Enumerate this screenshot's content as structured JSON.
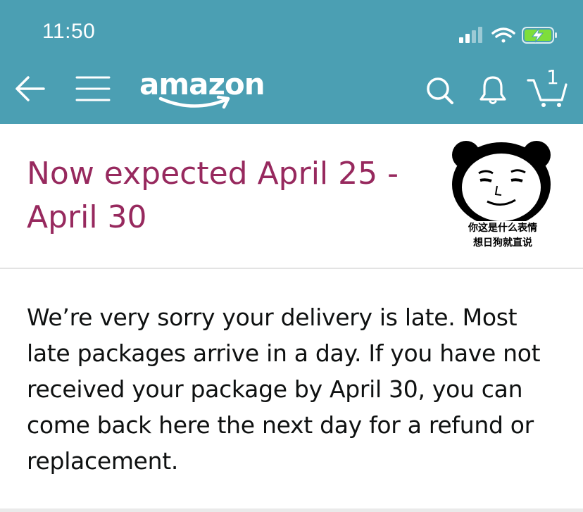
{
  "status_bar": {
    "time": "11:50",
    "icons": [
      "signal-icon",
      "wifi-icon",
      "battery-charging-icon"
    ]
  },
  "nav": {
    "logo_text": "amazon",
    "cart_count": "1",
    "icons": [
      "back-arrow-icon",
      "menu-icon",
      "search-icon",
      "bell-icon",
      "cart-icon"
    ],
    "header_color": "#4b9fb3"
  },
  "delivery": {
    "expected": "Now expected April 25 - April 30",
    "accent_color": "#97295e"
  },
  "meme": {
    "caption_line1": "你这是什么表情",
    "caption_line2": "想日狗就直说"
  },
  "message": {
    "text": "We’re very sorry your delivery is late. Most late packages arrive in a day. If you have not received your package by April 30, you can come back here the next day for a refund or replacement."
  }
}
